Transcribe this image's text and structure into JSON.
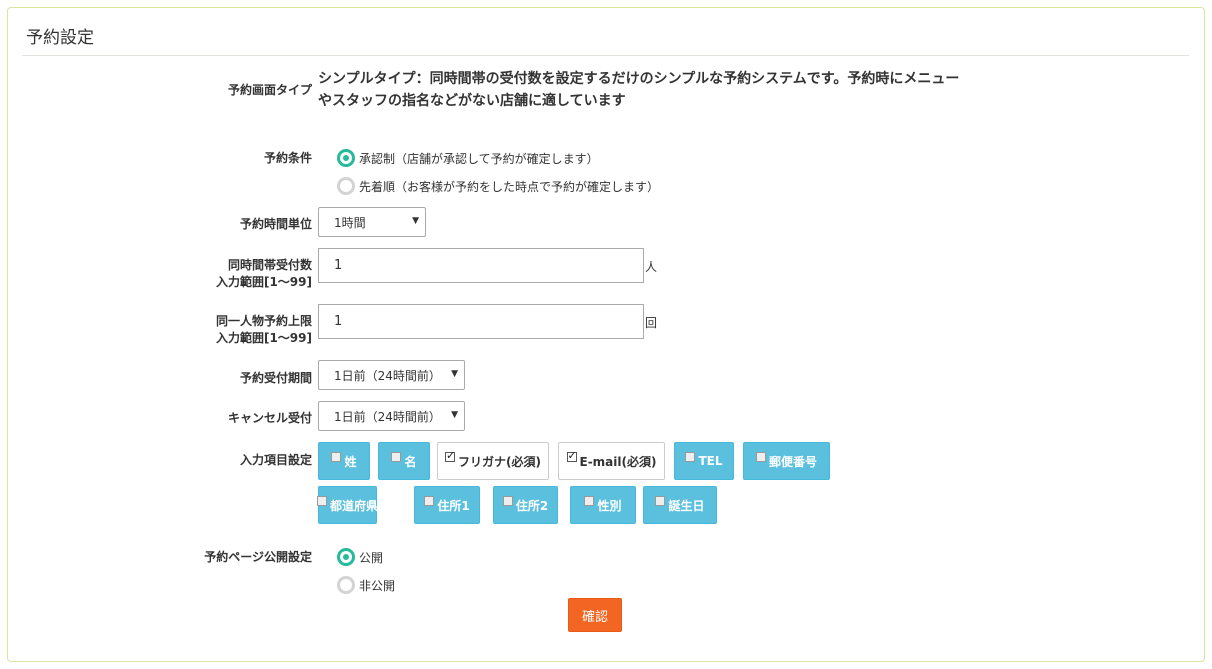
{
  "panel": {
    "title": "予約設定"
  },
  "reservation_type": {
    "label": "予約画面タイプ",
    "text": "シンプルタイプ：同時間帯の受付数を設定するだけのシンプルな予約システムです。予約時にメニューやスタッフの指名などがない店舗に適しています"
  },
  "conditions": {
    "label": "予約条件",
    "options": [
      {
        "label": "承認制（店舗が承認して予約が確定します）",
        "selected": true
      },
      {
        "label": "先着順（お客様が予約をした時点で予約が確定します）",
        "selected": false
      }
    ]
  },
  "time_unit": {
    "label": "予約時間単位",
    "value": "1時間"
  },
  "concurrent": {
    "label_line1": "同時間帯受付数",
    "label_line2": "入力範囲[1〜99]",
    "value": "1",
    "unit": "人"
  },
  "per_person": {
    "label_line1": "同一人物予約上限",
    "label_line2": "入力範囲[1〜99]",
    "value": "1",
    "unit": "回"
  },
  "acceptance_period": {
    "label": "予約受付期間",
    "value": "1日前（24時間前）"
  },
  "cancel": {
    "label": "キャンセル受付",
    "value": "1日前（24時間前）"
  },
  "fields": {
    "label": "入力項目設定",
    "items": [
      {
        "label": "姓",
        "checked": false
      },
      {
        "label": "名",
        "checked": false
      },
      {
        "label": "フリガナ(必須)",
        "checked": true
      },
      {
        "label": "E-mail(必須)",
        "checked": true
      },
      {
        "label": "TEL",
        "checked": false
      },
      {
        "label": "郵便番号",
        "checked": false
      },
      {
        "label": "都道府県",
        "checked": false
      },
      {
        "label": "住所1",
        "checked": false
      },
      {
        "label": "住所2",
        "checked": false
      },
      {
        "label": "性別",
        "checked": false
      },
      {
        "label": "誕生日",
        "checked": false
      }
    ]
  },
  "visibility": {
    "label": "予約ページ公開設定",
    "options": [
      {
        "label": "公開",
        "selected": true
      },
      {
        "label": "非公開",
        "selected": false
      }
    ]
  },
  "confirm_label": "確認",
  "colors": {
    "accent": "#26b99a",
    "chip": "#5bc0de",
    "confirm": "#f26522"
  },
  "icons": {
    "radio": "radio-icon",
    "checkbox": "checkbox-icon",
    "dropdown": "caret-down-icon"
  }
}
